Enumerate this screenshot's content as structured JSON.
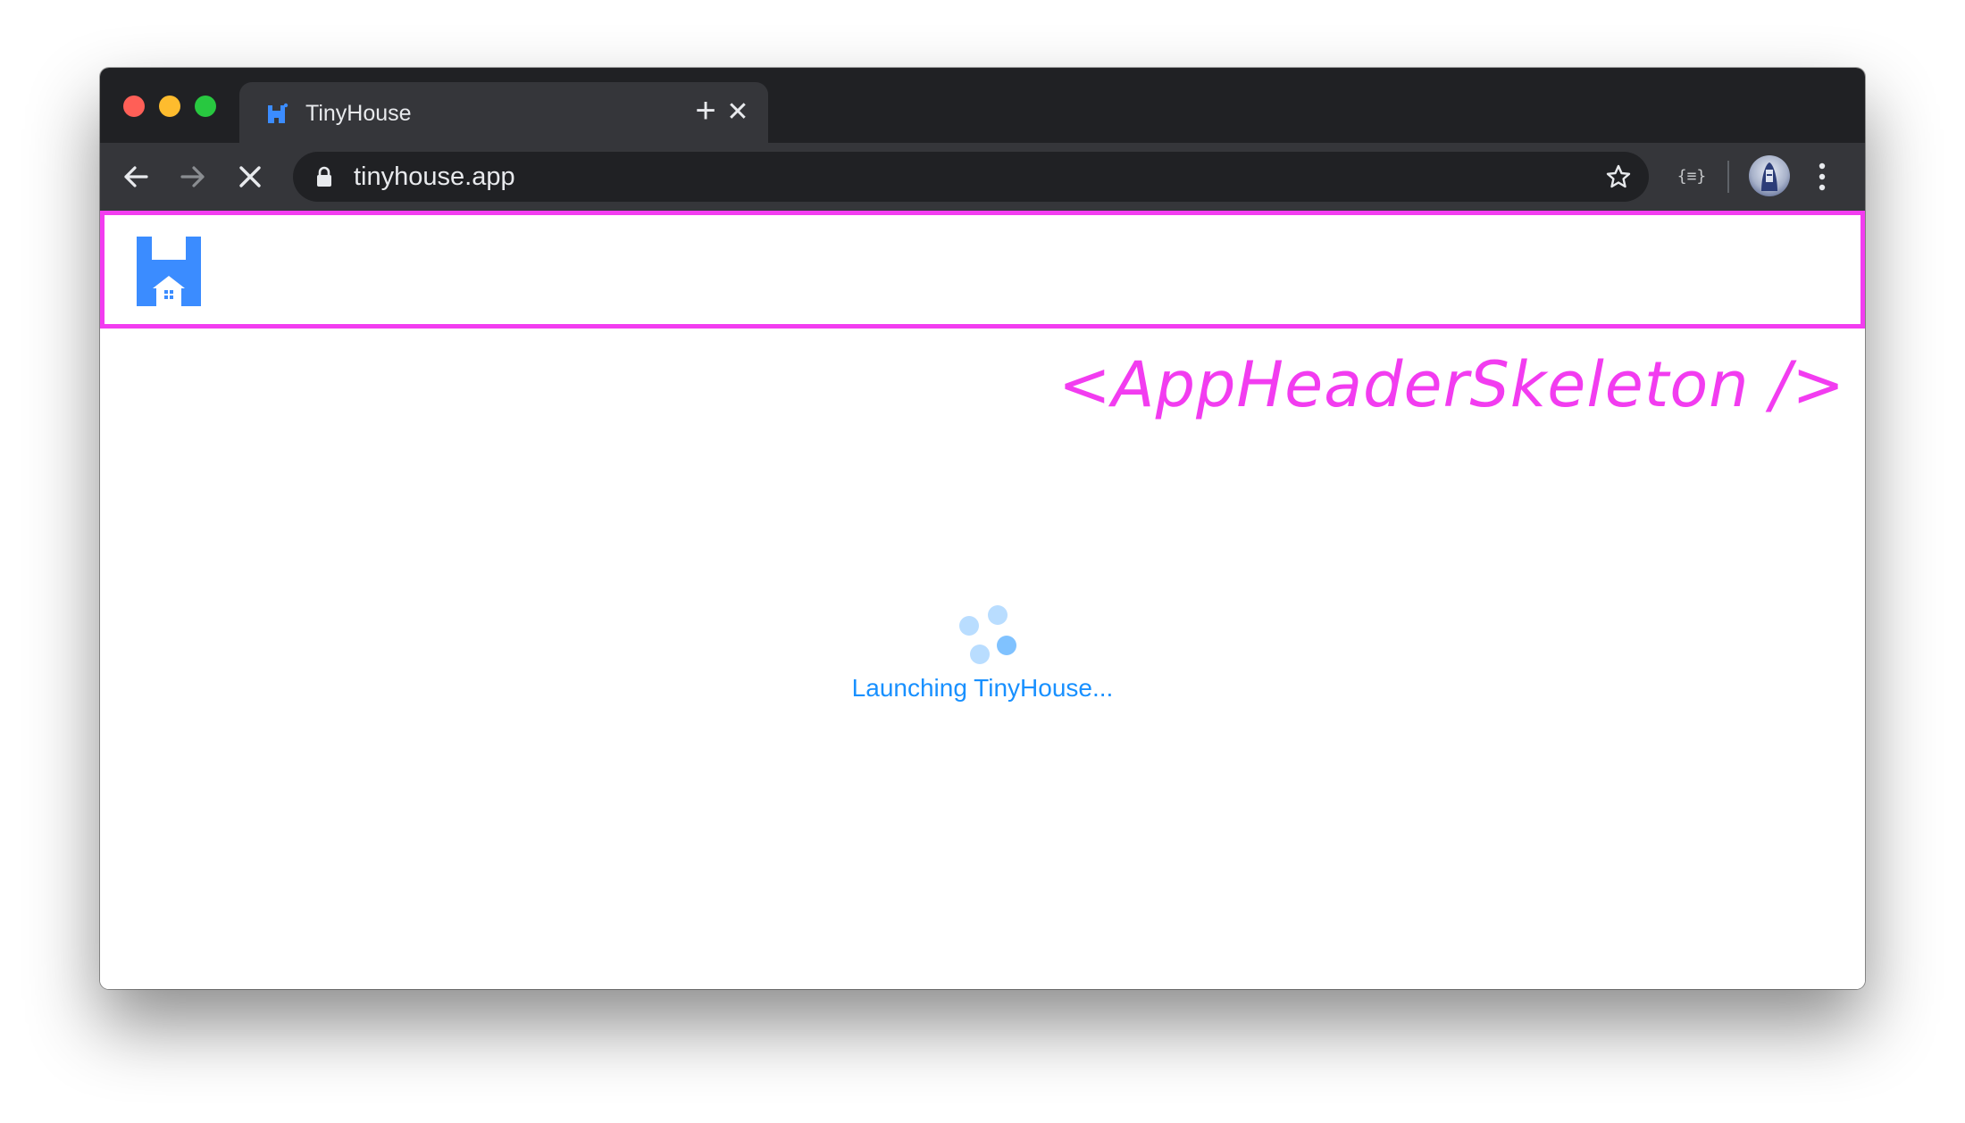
{
  "browser": {
    "tab": {
      "title": "TinyHouse",
      "close_symbol": "✕",
      "favicon": "tinyhouse-logo-icon"
    },
    "new_tab_symbol": "+",
    "address_bar": {
      "url": "tinyhouse.app",
      "secure": true
    },
    "extension_label": "{≡}",
    "colors": {
      "frame": "#202124",
      "toolbar": "#35363a",
      "text": "#e8eaed"
    }
  },
  "page": {
    "logo_icon": "tinyhouse-h-logo",
    "annotation": "<AppHeaderSkeleton />",
    "annotation_color": "#f23cf0",
    "loading_text": "Launching TinyHouse...",
    "accent_color": "#1890ff"
  }
}
